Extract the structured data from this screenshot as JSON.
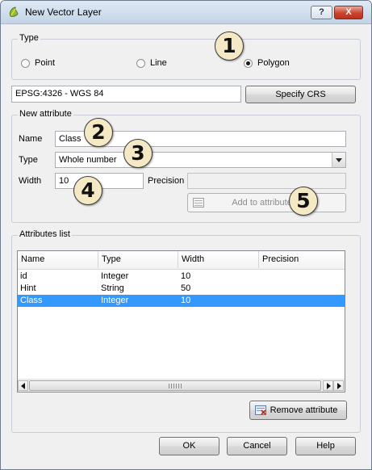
{
  "window": {
    "title": "New Vector Layer",
    "help_label": "?",
    "close_label": "X"
  },
  "type_group": {
    "title": "Type",
    "options": [
      {
        "label": "Point",
        "selected": false
      },
      {
        "label": "Line",
        "selected": false
      },
      {
        "label": "Polygon",
        "selected": true
      }
    ]
  },
  "crs": {
    "value": "EPSG:4326 - WGS 84",
    "button_label": "Specify CRS"
  },
  "new_attribute": {
    "title": "New attribute",
    "name_label": "Name",
    "name_value": "Class",
    "type_label": "Type",
    "type_value": "Whole number",
    "width_label": "Width",
    "width_value": "10",
    "precision_label": "Precision",
    "precision_value": "",
    "add_button_label": "Add to attributes list"
  },
  "attributes_list": {
    "title": "Attributes list",
    "columns": [
      "Name",
      "Type",
      "Width",
      "Precision"
    ],
    "rows": [
      {
        "name": "id",
        "type": "Integer",
        "width": "10",
        "precision": "",
        "selected": false
      },
      {
        "name": "Hint",
        "type": "String",
        "width": "50",
        "precision": "",
        "selected": false
      },
      {
        "name": "Class",
        "type": "Integer",
        "width": "10",
        "precision": "",
        "selected": true
      }
    ],
    "remove_button_label": "Remove attribute"
  },
  "footer": {
    "ok_label": "OK",
    "cancel_label": "Cancel",
    "help_label": "Help"
  },
  "callouts": [
    "1",
    "2",
    "3",
    "4",
    "5"
  ],
  "colors": {
    "selection": "#3399ff",
    "callout_fill": "#f5e8c4",
    "close_button": "#c9452e"
  },
  "icons": [
    "qgis-app-icon",
    "add-to-list-icon",
    "remove-attribute-icon"
  ]
}
